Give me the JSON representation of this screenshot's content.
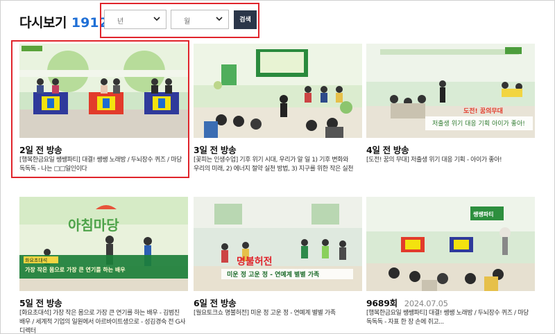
{
  "header": {
    "title": "다시보기",
    "count": "1912"
  },
  "filter": {
    "year_placeholder": "년",
    "month_placeholder": "월",
    "search_label": "검색"
  },
  "episodes": [
    {
      "date": "2일 전 방송",
      "desc": "[행복한금요일 쌩쌩파티] 대결! 쌩쌩 노래방 / 두뇌장수 퀴즈 / 마당 독독독 - 나는 □□일인이다",
      "thumb_caption": ""
    },
    {
      "date": "3일 전 방송",
      "desc": "[꽃피는 인생수업] 기후 위기 시대, 우리가 알 일 1) 기후 변화와 우리의 미래, 2) 에너지 절약 실천 방법, 3) 지구를 위한 작은 실천",
      "thumb_caption": ""
    },
    {
      "date": "4일 전 방송",
      "desc": "[도전! 꿈의 무대] 저출생 위기 대응 기획 - 아이가 좋아!",
      "thumb_caption": "저출생 위기 대응 기획 아이가 좋아!"
    },
    {
      "date": "5일 전 방송",
      "desc": "[화요초대석] 가장 작은 몸으로 가장 큰 연기를 하는 배우 - 김범진 배우 / 세계적 기업의 일원에서 아르바이트생으로 - 성김경숙 전 G사 디렉터",
      "thumb_caption": "가장 작은 몸으로 가장 큰 연기를 하는 배우"
    },
    {
      "date": "6일 전 방송",
      "desc": "[월요토크쇼 명불허전] 미운 정 고운 정 - 연예계 별별 가족",
      "thumb_caption": "미운 정 고운 정 - 연예계 별별 가족"
    },
    {
      "date": "9689회",
      "date_sub": "2024.07.05",
      "desc": "[행복한금요일 쌩쌩파티] 대결! 쌩쌩 노래방 / 두뇌장수 퀴즈 / 마당 독독독 - 자표 한 장 손에 쥐고...",
      "thumb_caption": ""
    }
  ],
  "thumb_texts": {
    "morning_logo": "아침마당",
    "talk_caption_title": "화요초대석",
    "myeongbul": "명불허전",
    "dream_stage": "도전! 꿈의무대",
    "sangsang": "쌩쌩파티"
  },
  "colors": {
    "accent_blue": "#1f6fd6",
    "highlight_red": "#e0242b",
    "button_dark": "#2b3649"
  }
}
